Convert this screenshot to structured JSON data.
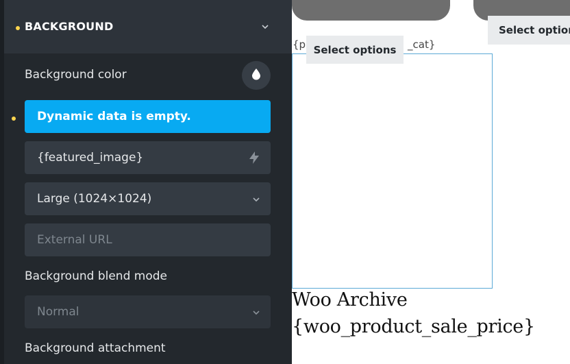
{
  "panel": {
    "section_title": "BACKGROUND",
    "background_color_label": "Background color",
    "dynamic_message": "Dynamic data is empty.",
    "image_field_value": "{featured_image}",
    "size_select_value": "Large (1024×1024)",
    "external_url_placeholder": "External URL",
    "blend_mode_label": "Background blend mode",
    "blend_mode_value": "Normal",
    "attachment_label": "Background attachment",
    "colors": {
      "accent": "#08aaf2",
      "modified_dot": "#ffd64f",
      "panel_bg": "#23282d"
    }
  },
  "preview": {
    "select_options_1": "Select options",
    "select_options_2": "Select options",
    "cat_left": "{po",
    "cat_right": "_cat}",
    "archive_title": "Woo Archive",
    "sale_price": "{woo_product_sale_price}"
  }
}
